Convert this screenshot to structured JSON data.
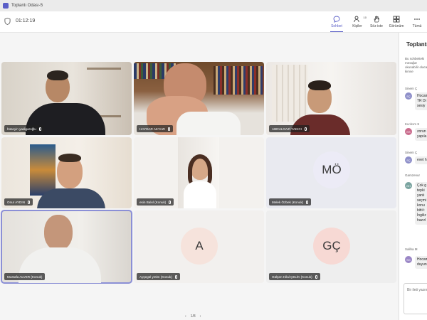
{
  "window": {
    "title": "Toplantı Odası-5"
  },
  "toolbar": {
    "timer": "01:12:19",
    "buttons": [
      {
        "label": "Sohbet",
        "active": true
      },
      {
        "label": "Kişiler",
        "count": "10"
      },
      {
        "label": "Söz iste"
      },
      {
        "label": "Görünüm"
      },
      {
        "label": "Tümü"
      }
    ]
  },
  "participants": [
    {
      "name": "hüseyin yadigaroğlu"
    },
    {
      "name": "HAYDAR AKYAZI"
    },
    {
      "name": "ABDULGAZİ YAKICI"
    },
    {
      "name": "Onur AYDIN"
    },
    {
      "name": "esin Bakıl (Konuk)"
    },
    {
      "name": "Melek Özbek (Konuk)",
      "initials": "MÖ"
    },
    {
      "name": "Mustafa ALVER (Konuk)"
    },
    {
      "name": "Ayşegül yetim (Konuk)",
      "initials": "A"
    },
    {
      "name": "Gülşen Hilal ÇELİK (Konuk)",
      "initials": "GÇ"
    }
  ],
  "pager": {
    "text": "1/8"
  },
  "chat": {
    "title": "Toplantı sohbeti",
    "intro": "Bu sohbetteki mesajlar okunabilir olacak kimse",
    "messages": [
      {
        "sender": "Sinem Ç",
        "initials": "SÇ",
        "text": "Hocam TR Di sesiy"
      },
      {
        "sender": "Kıvılcım S",
        "initials": "KS",
        "text": "zorun yapıla"
      },
      {
        "sender": "Sinem Ç",
        "initials": "SÇ",
        "text": "evet h"
      },
      {
        "sender": "Gamzenur",
        "initials": "GH",
        "text": "Çok g tepki yanlı seçmi konu bitti t İngiliz hazırl"
      },
      {
        "sender": "Saliha M",
        "initials": "SG",
        "text": "Hocam duyun"
      }
    ],
    "compose_placeholder": "Bir ileti yazın"
  },
  "colors": {
    "accent": "#5b5fc7",
    "avatar_mo": "#ecebf6",
    "avatar_a": "#f6e3dc",
    "avatar_gc": "#f7d9d4"
  }
}
